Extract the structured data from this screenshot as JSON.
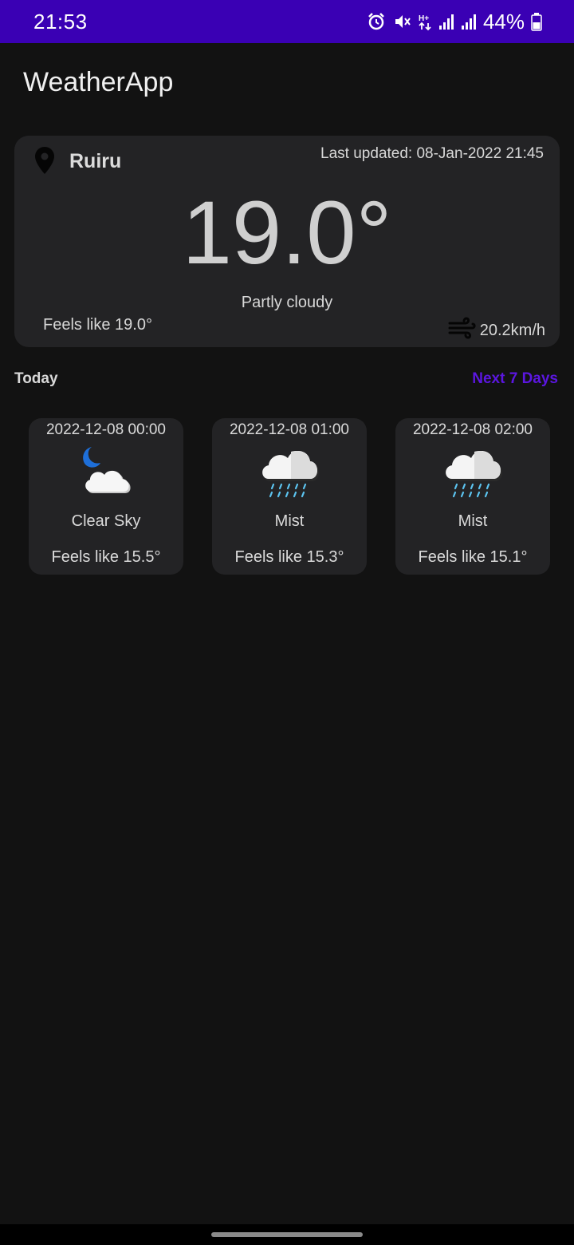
{
  "status_bar": {
    "time": "21:53",
    "battery_percent": "44%",
    "icons": [
      "alarm-icon",
      "mute-icon",
      "data-arrows-icon",
      "signal-icon",
      "signal-icon",
      "battery-icon"
    ],
    "background": "#3a00b4"
  },
  "app": {
    "title": "WeatherApp"
  },
  "current": {
    "location": "Ruiru",
    "last_updated": "Last updated: 08-Jan-2022 21:45",
    "temperature": "19.0°",
    "condition": "Partly cloudy",
    "feels_like": "Feels like 19.0°",
    "wind": "20.2km/h",
    "icons": [
      "location-pin-icon",
      "wind-icon"
    ]
  },
  "section": {
    "today_label": "Today",
    "next_label": "Next 7 Days",
    "accent": "#5b16e0"
  },
  "forecast": [
    {
      "time": "2022-12-08 00:00",
      "description": "Clear Sky",
      "feels": "Feels like 15.5°",
      "icon": "moon-cloud-icon"
    },
    {
      "time": "2022-12-08 01:00",
      "description": "Mist",
      "feels": "Feels like 15.3°",
      "icon": "rain-cloud-icon"
    },
    {
      "time": "2022-12-08 02:00",
      "description": "Mist",
      "feels": "Feels like 15.1°",
      "icon": "rain-cloud-icon"
    }
  ]
}
